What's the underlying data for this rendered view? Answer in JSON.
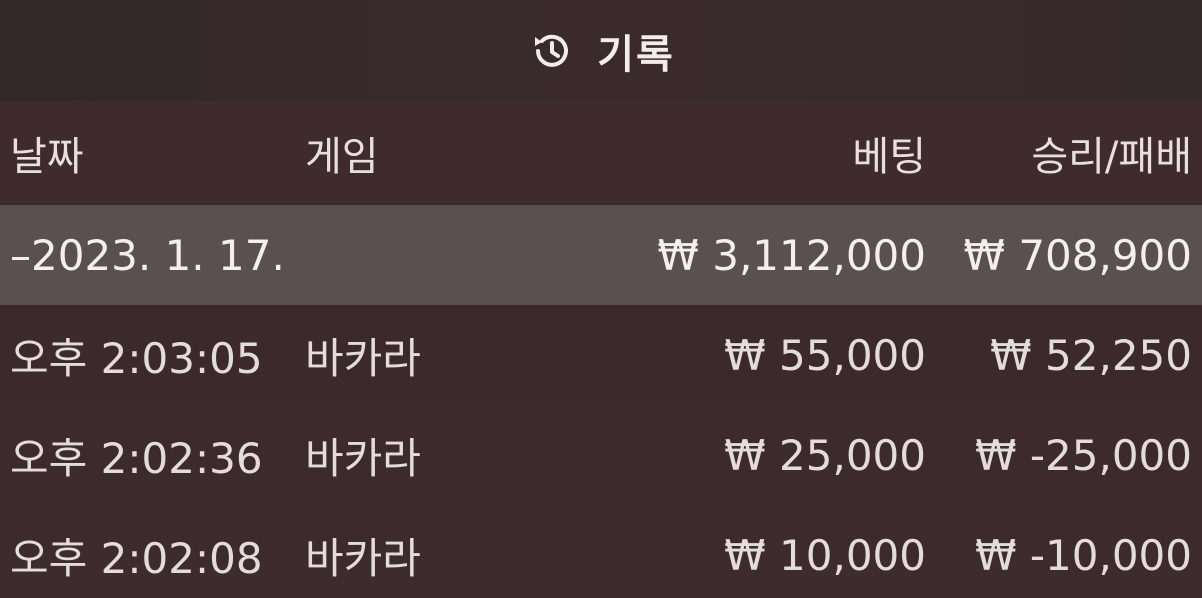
{
  "title": {
    "icon": "history-icon",
    "text": "기록"
  },
  "columns": {
    "date": "날짜",
    "game": "게임",
    "bet": "베팅",
    "result": "승리/패배"
  },
  "summary": {
    "date": "–2023. 1. 17.",
    "bet": "₩ 3,112,000",
    "result": "₩ 708,900"
  },
  "rows": [
    {
      "time": "오후 2:03:05",
      "game": "바카라",
      "bet": "₩ 55,000",
      "result": "₩ 52,250"
    },
    {
      "time": "오후 2:02:36",
      "game": "바카라",
      "bet": "₩ 25,000",
      "result": "₩ -25,000"
    },
    {
      "time": "오후 2:02:08",
      "game": "바카라",
      "bet": "₩ 10,000",
      "result": "₩ -10,000"
    }
  ]
}
